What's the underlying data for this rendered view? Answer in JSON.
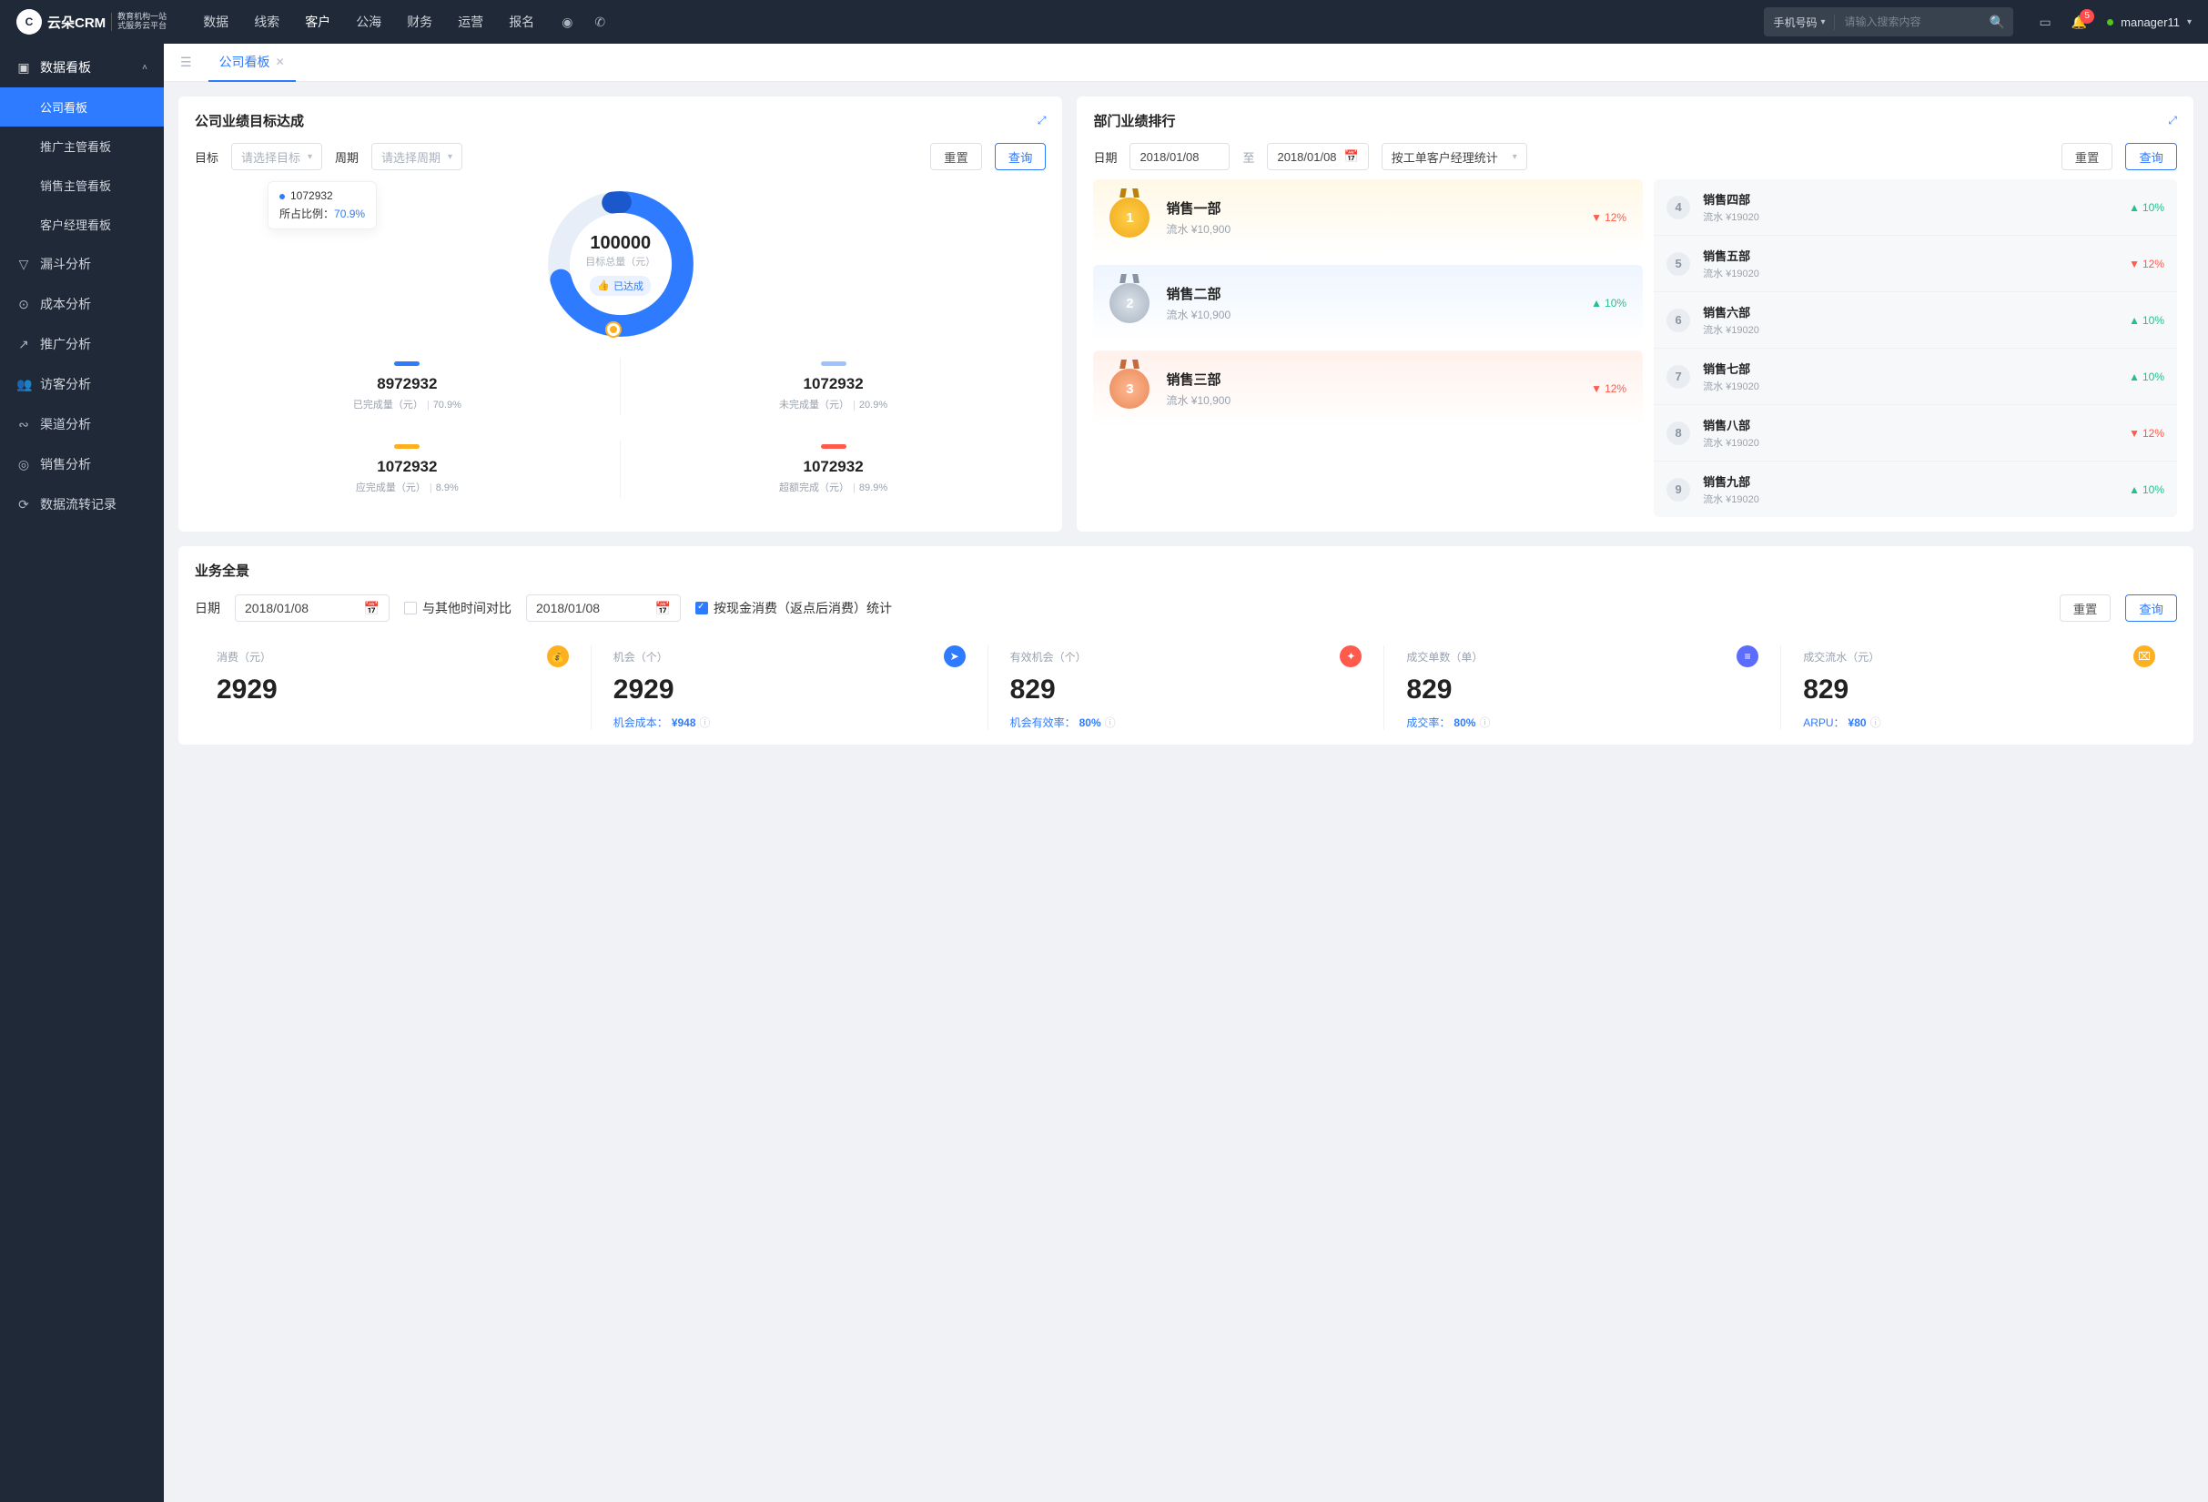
{
  "brand": {
    "name": "云朵CRM",
    "sub1": "教育机构一站",
    "sub2": "式服务云平台"
  },
  "nav": [
    "数据",
    "线索",
    "客户",
    "公海",
    "财务",
    "运营",
    "报名"
  ],
  "nav_active_index": 2,
  "search": {
    "type": "手机号码",
    "placeholder": "请输入搜索内容"
  },
  "notif_count": "5",
  "user": "manager11",
  "sidebar": {
    "group": "数据看板",
    "items": [
      "公司看板",
      "推广主管看板",
      "销售主管看板",
      "客户经理看板"
    ],
    "active_index": 0,
    "roots": [
      "漏斗分析",
      "成本分析",
      "推广分析",
      "访客分析",
      "渠道分析",
      "销售分析",
      "数据流转记录"
    ]
  },
  "tab": {
    "label": "公司看板"
  },
  "goals": {
    "title": "公司业绩目标达成",
    "lbl_target": "目标",
    "target_ph": "请选择目标",
    "lbl_period": "周期",
    "period_ph": "请选择周期",
    "reset": "重置",
    "query": "查询",
    "tip_val": "1072932",
    "tip_lbl": "所占比例：",
    "tip_pct": "70.9%",
    "center_val": "100000",
    "center_sub": "目标总量（元）",
    "badge": "已达成",
    "metrics": [
      {
        "bar": "b-blue",
        "val": "8972932",
        "lbl": "已完成量（元）",
        "pct": "70.9%"
      },
      {
        "bar": "b-lblue",
        "val": "1072932",
        "lbl": "未完成量（元）",
        "pct": "20.9%"
      },
      {
        "bar": "b-org",
        "val": "1072932",
        "lbl": "应完成量（元）",
        "pct": "8.9%"
      },
      {
        "bar": "b-red",
        "val": "1072932",
        "lbl": "超额完成（元）",
        "pct": "89.9%"
      }
    ]
  },
  "chart_data": {
    "type": "pie",
    "title": "公司业绩目标达成",
    "center_label": "目标总量（元）",
    "center_value": 100000,
    "slices": [
      {
        "name": "已完成量",
        "value": 8972932,
        "pct": 70.9,
        "color": "#2f7bff"
      },
      {
        "name": "未完成量",
        "value": 1072932,
        "pct": 20.9,
        "color": "#9cc3ff"
      },
      {
        "name": "应完成量",
        "value": 1072932,
        "pct": 8.9,
        "color": "#ffb020"
      }
    ],
    "status": "已达成"
  },
  "rank": {
    "title": "部门业绩排行",
    "lbl_date": "日期",
    "date_from": "2018/01/08",
    "date_sep": "至",
    "date_to": "2018/01/08",
    "group_by": "按工单客户经理统计",
    "reset": "重置",
    "query": "查询",
    "podium": [
      {
        "name": "销售一部",
        "sub": "流水 ¥10,900",
        "delta": "12%",
        "dir": "down"
      },
      {
        "name": "销售二部",
        "sub": "流水 ¥10,900",
        "delta": "10%",
        "dir": "up"
      },
      {
        "name": "销售三部",
        "sub": "流水 ¥10,900",
        "delta": "12%",
        "dir": "down"
      }
    ],
    "list": [
      {
        "n": "4",
        "name": "销售四部",
        "sub": "流水 ¥19020",
        "delta": "10%",
        "dir": "up"
      },
      {
        "n": "5",
        "name": "销售五部",
        "sub": "流水 ¥19020",
        "delta": "12%",
        "dir": "down"
      },
      {
        "n": "6",
        "name": "销售六部",
        "sub": "流水 ¥19020",
        "delta": "10%",
        "dir": "up"
      },
      {
        "n": "7",
        "name": "销售七部",
        "sub": "流水 ¥19020",
        "delta": "10%",
        "dir": "up"
      },
      {
        "n": "8",
        "name": "销售八部",
        "sub": "流水 ¥19020",
        "delta": "12%",
        "dir": "down"
      },
      {
        "n": "9",
        "name": "销售九部",
        "sub": "流水 ¥19020",
        "delta": "10%",
        "dir": "up"
      }
    ]
  },
  "overview": {
    "title": "业务全景",
    "lbl_date": "日期",
    "date": "2018/01/08",
    "chk_compare": "与其他时间对比",
    "date2": "2018/01/08",
    "chk_cash": "按现金消费（返点后消费）统计",
    "reset": "重置",
    "query": "查询",
    "stats": [
      {
        "lbl": "消费（元）",
        "val": "2929",
        "ico": "i-org",
        "glyph": "💰",
        "foot": ""
      },
      {
        "lbl": "机会（个）",
        "val": "2929",
        "ico": "i-blue",
        "glyph": "➤",
        "foot": "机会成本：",
        "footv": "¥948"
      },
      {
        "lbl": "有效机会（个）",
        "val": "829",
        "ico": "i-red",
        "glyph": "✦",
        "foot": "机会有效率：",
        "footv": "80%"
      },
      {
        "lbl": "成交单数（单）",
        "val": "829",
        "ico": "i-pur",
        "glyph": "≡",
        "foot": "成交率：",
        "footv": "80%"
      },
      {
        "lbl": "成交流水（元）",
        "val": "829",
        "ico": "i-org",
        "glyph": "⌧",
        "foot": "ARPU：",
        "footv": "¥80"
      }
    ]
  }
}
